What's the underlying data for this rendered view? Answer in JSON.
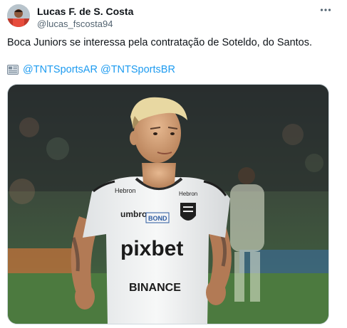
{
  "tweet": {
    "author": {
      "display_name": "Lucas F. de S. Costa",
      "handle": "@lucas_fscosta94"
    },
    "text": "Boca Juniors se interessa pela contratação de Soteldo, do Santos.",
    "mentions": [
      "@TNTSportsAR",
      "@TNTSportsBR"
    ],
    "media": {
      "kind": "photo",
      "jersey_texts": {
        "sponsor_chest": "pixbet",
        "sponsor_lower": "BINANCE",
        "brand": "umbro",
        "sleeve_left": "Hebron",
        "sleeve_right": "Hebron",
        "patch": "BOND"
      }
    }
  },
  "colors": {
    "link": "#1d9bf0",
    "text": "#0f1419",
    "secondary": "#536471"
  },
  "icons": {
    "more": "more-horizontal-icon",
    "news": "newspaper-icon"
  }
}
